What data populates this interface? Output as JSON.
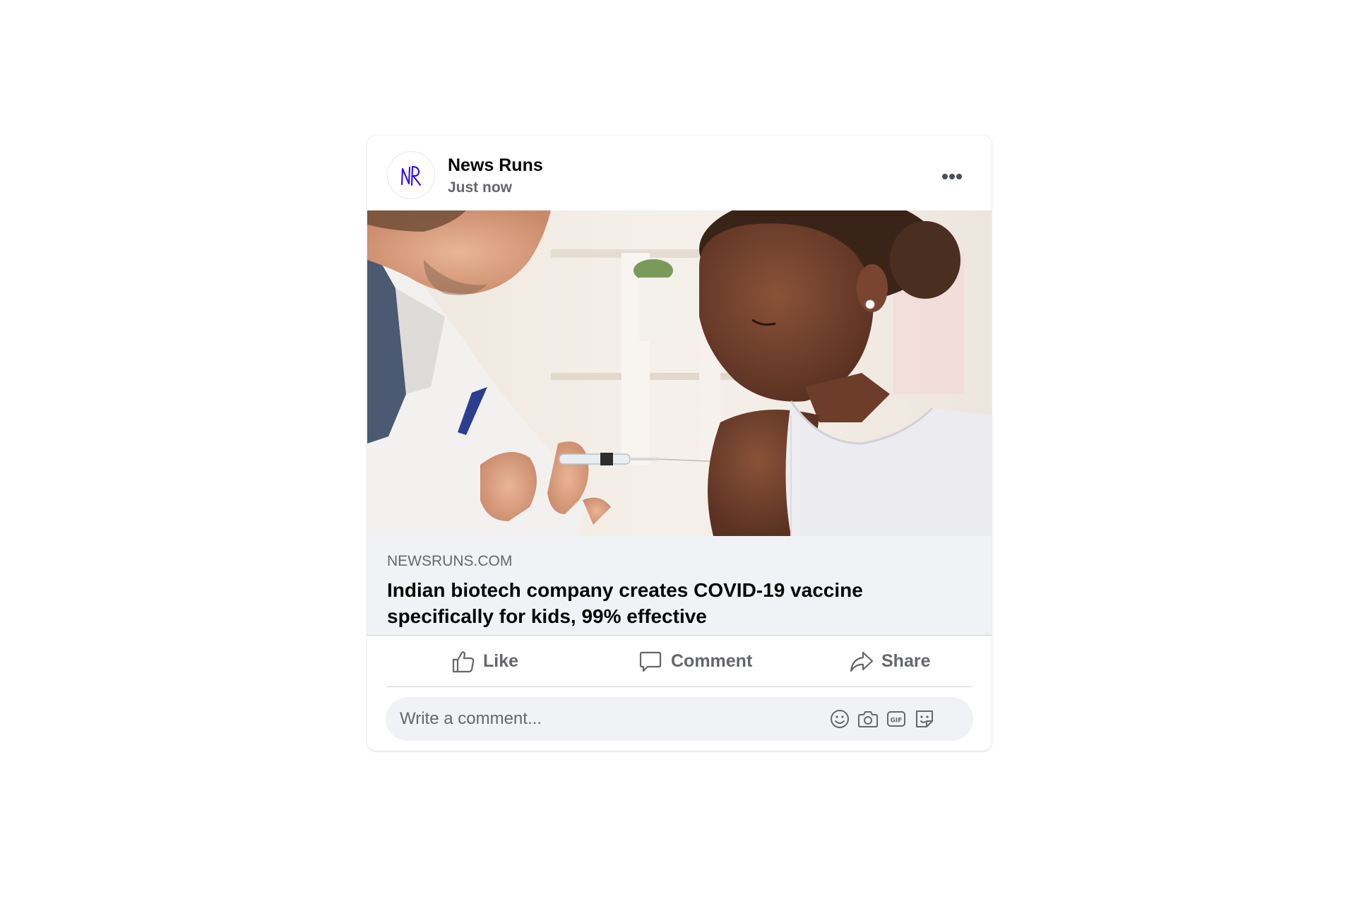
{
  "post": {
    "author": "News Runs",
    "timestamp": "Just now",
    "avatar_initials": "NR",
    "more_icon": "more-horizontal-icon"
  },
  "link_preview": {
    "domain": "NEWSRUNS.COM",
    "title": "Indian biotech company creates COVID-19 vaccine specifically for kids, 99% effective"
  },
  "actions": {
    "like_label": "Like",
    "comment_label": "Comment",
    "share_label": "Share"
  },
  "comment_box": {
    "placeholder": "Write a comment...",
    "icons": [
      "emoji-icon",
      "camera-icon",
      "gif-icon",
      "sticker-icon"
    ]
  },
  "colors": {
    "primary_text": "#050505",
    "secondary_text": "#65676b",
    "surface": "#f0f2f5",
    "avatar_logo": "#2a00ff"
  }
}
